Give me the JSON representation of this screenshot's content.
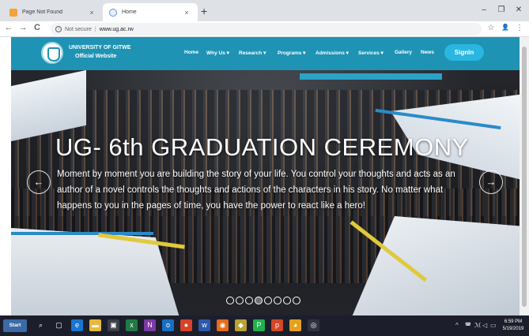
{
  "browser": {
    "tabs": [
      {
        "title": "Page Not Found",
        "active": false
      },
      {
        "title": "Home",
        "active": true
      }
    ],
    "new_tab": "+",
    "close_glyph": "×",
    "window_controls": {
      "minimize": "–",
      "maximize": "❐",
      "close": "✕"
    },
    "address": {
      "security_label": "Not secure",
      "separator": "|",
      "url": "www.ug.ac.rw"
    },
    "nav_glyphs": {
      "back": "←",
      "forward": "→",
      "reload": "C"
    },
    "toolbar_glyphs": {
      "bookmark": "☆",
      "profile": "👤",
      "menu": "⋮"
    }
  },
  "site": {
    "brand_name": "UNIVERSITY OF GITWE",
    "brand_subtitle": "Official Website",
    "nav": [
      {
        "label": "Home"
      },
      {
        "label": "Why Us ▾"
      },
      {
        "label": "Research ▾"
      },
      {
        "label": "Programs ▾"
      },
      {
        "label": "Admissions ▾"
      },
      {
        "label": "Services ▾"
      },
      {
        "label": "Gallery"
      },
      {
        "label": "News"
      }
    ],
    "signin_label": "SignIn",
    "accent_color": "#1f93b4"
  },
  "hero": {
    "title": "UG- 6th GRADUATION CEREMONY",
    "text": "Moment by moment you are building the story of your life. You control your thoughts and acts as an author of a novel controls the thoughts and actions of the characters in his story. No matter what happens to you in the pages of time, you have the power to react like a hero!",
    "prev_glyph": "←",
    "next_glyph": "→",
    "slide_count": 8,
    "active_slide": 3
  },
  "taskbar": {
    "start_label": "Start",
    "icons": [
      "search-icon",
      "task-view-icon",
      "edge-icon",
      "file-explorer-icon",
      "store-icon",
      "excel-icon",
      "onenote-icon",
      "outlook-icon",
      "media-icon",
      "word-icon",
      "firefox-icon",
      "app-icon",
      "pycharm-icon",
      "powerpoint-icon",
      "chrome-icon",
      "obs-icon"
    ],
    "clock_time": "6:59 PM",
    "clock_date": "5/19/2019"
  }
}
